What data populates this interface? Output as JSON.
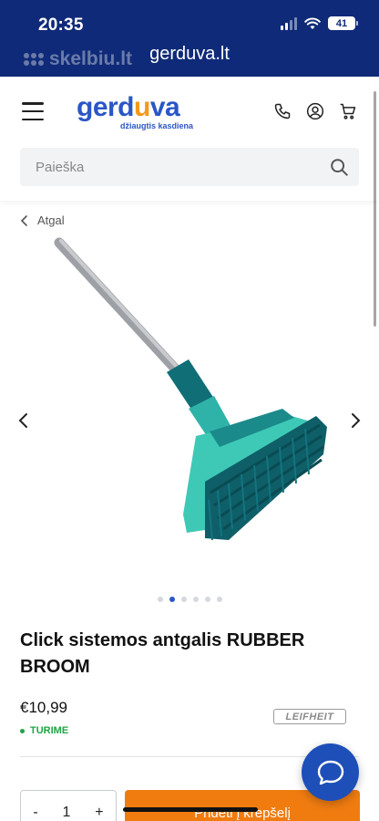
{
  "status_bar": {
    "time": "20:35",
    "battery": "41"
  },
  "browser": {
    "url": "gerduva.lt",
    "watermark": "skelbiu.lt"
  },
  "header": {
    "logo_left": "gerd",
    "logo_accent": "u",
    "logo_right": "va",
    "tagline": "džiaugtis kasdiena",
    "icons": [
      "menu-icon",
      "phone-icon",
      "user-icon",
      "cart-icon"
    ]
  },
  "search": {
    "placeholder": "Paieška"
  },
  "nav": {
    "back_label": "Atgal"
  },
  "gallery": {
    "dot_count": 6,
    "active_index": 1
  },
  "product": {
    "title": "Click sistemos antgalis RUBBER BROOM",
    "price": "€10,99",
    "stock": "TURIME",
    "brand": "LEIFHEIT"
  },
  "purchase": {
    "minus": "-",
    "quantity": "1",
    "plus": "+",
    "add_to_cart": "Pridėti į krepšelį"
  },
  "colors": {
    "brand_blue": "#2a56c6",
    "accent_orange": "#f07c10",
    "status_bar": "#0f2a78",
    "stock_green": "#1fa645"
  }
}
